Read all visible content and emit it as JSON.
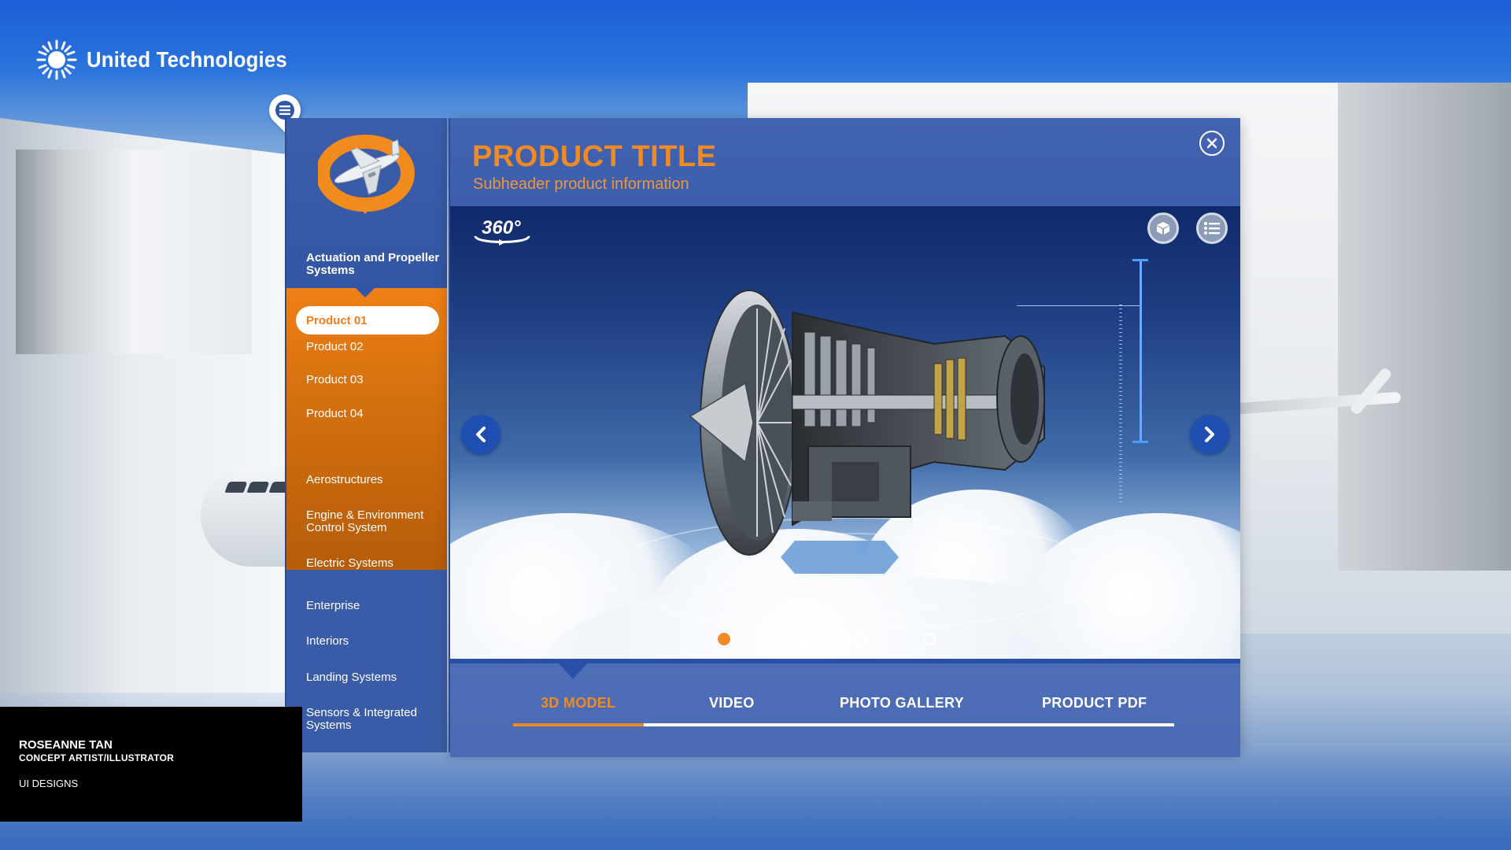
{
  "brand": {
    "name": "United Technologies"
  },
  "sidebar": {
    "category_title": "Actuation and Propeller Systems",
    "products": [
      {
        "label": "Product 01",
        "active": true
      },
      {
        "label": "Product 02"
      },
      {
        "label": "Product 03"
      },
      {
        "label": "Product 04"
      }
    ],
    "categories": [
      "Aerostructures",
      "Engine & Environment Control System",
      "Electric Systems",
      "Enterprise",
      "Interiors",
      "Landing Systems",
      "Sensors & Integrated Systems"
    ]
  },
  "product": {
    "title": "PRODUCT TITLE",
    "subheader": "Subheader product information",
    "badge_360": "360°"
  },
  "carousel": {
    "total": 4,
    "active_index": 0
  },
  "tabs": [
    {
      "label": "3D MODEL",
      "active": true
    },
    {
      "label": "VIDEO"
    },
    {
      "label": "PHOTO GALLERY"
    },
    {
      "label": "PRODUCT PDF"
    }
  ],
  "credits": {
    "name": "ROSEANNE TAN",
    "role": "CONCEPT ARTIST/ILLUSTRATOR",
    "project": "UI DESIGNS"
  },
  "colors": {
    "accent_orange": "#f08a24",
    "panel_blue": "#4a6ab6",
    "nav_blue": "#1f4fb1"
  },
  "icons": [
    "sunburst-logo-icon",
    "menu-icon",
    "close-icon",
    "cube-icon",
    "list-icon",
    "chevron-left-icon",
    "chevron-right-icon",
    "rotate-360-icon",
    "plane-emblem-icon"
  ]
}
